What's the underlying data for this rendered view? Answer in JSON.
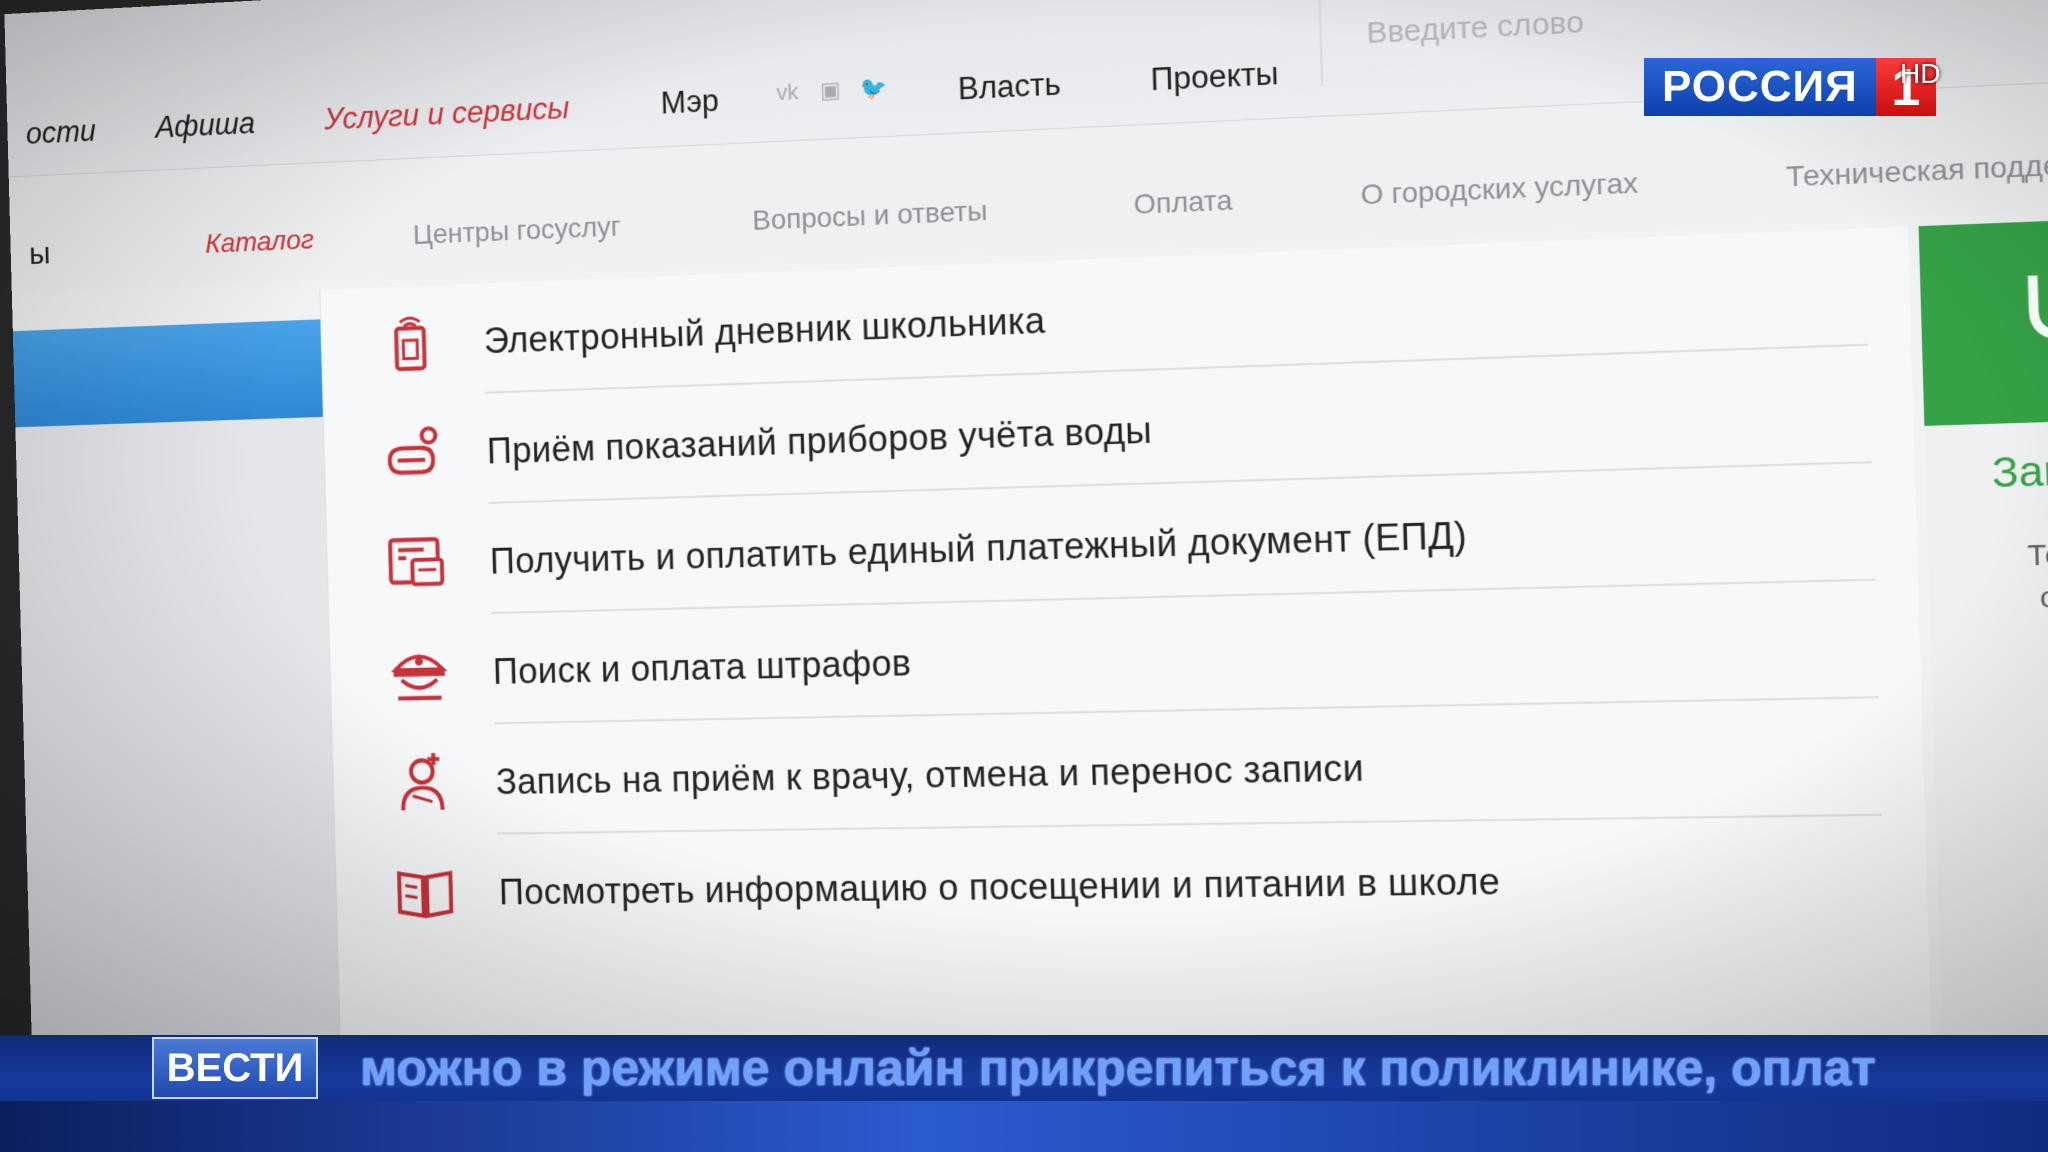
{
  "top_nav": {
    "items": [
      {
        "label": "ости",
        "style": "italic"
      },
      {
        "label": "Афиша",
        "style": "italic"
      },
      {
        "label": "Услуги и сервисы",
        "style": "active"
      },
      {
        "label": "Мэр",
        "style": "normal"
      },
      {
        "label": "Власть",
        "style": "normal"
      },
      {
        "label": "Проекты",
        "style": "normal"
      }
    ],
    "social_icons": [
      "vk-icon",
      "instagram-icon",
      "twitter-icon"
    ],
    "search_placeholder": "Введите слово"
  },
  "sub_nav": {
    "left_fragment": "ы",
    "tabs": [
      {
        "label": "Каталог",
        "active": true
      },
      {
        "label": "Центры госуслуг",
        "active": false
      },
      {
        "label": "Вопросы и ответы",
        "active": false
      },
      {
        "label": "Оплата",
        "active": false
      },
      {
        "label": "О городских услугах",
        "active": false
      },
      {
        "label": "Техническая поддер",
        "active": false
      }
    ]
  },
  "services": [
    {
      "label": "Электронный дневник школьника",
      "icon": "school-diary-icon"
    },
    {
      "label": "Приём показаний приборов учёта воды",
      "icon": "water-meter-icon"
    },
    {
      "label": "Получить и оплатить единый платежный документ (ЕПД)",
      "icon": "payment-document-icon"
    },
    {
      "label": "Поиск и оплата штрафов",
      "icon": "traffic-police-cap-icon"
    },
    {
      "label": "Запись на приём к врачу, отмена и перенос записи",
      "icon": "doctor-icon"
    },
    {
      "label": "Посмотреть информацию о посещении и питании в школе",
      "icon": "open-book-icon"
    }
  ],
  "right_widget": {
    "icon": "stethoscope-icon",
    "title": "Зап",
    "text_line1": "Теп",
    "text_line2": "одн"
  },
  "broadcast": {
    "channel_name": "РОССИЯ",
    "channel_number": "1",
    "hd": "HD",
    "program": "ВЕСТИ",
    "ticker": "можно в режиме онлайн прикрепиться к поликлинике, оплат"
  },
  "colors": {
    "accent_red": "#d0353a",
    "icon_red": "#c8323a",
    "widget_green": "#35a247",
    "left_panel_blue": "#2f88d6",
    "ticker_blue": "#163aa0"
  }
}
